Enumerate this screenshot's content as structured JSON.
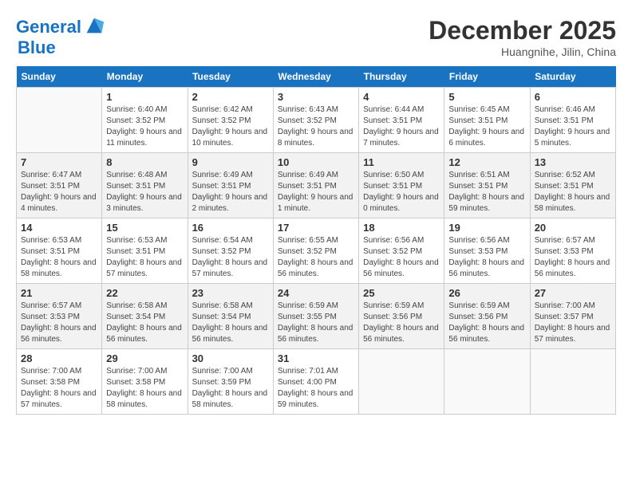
{
  "header": {
    "logo_line1": "General",
    "logo_line2": "Blue",
    "month": "December 2025",
    "location": "Huangnihe, Jilin, China"
  },
  "weekdays": [
    "Sunday",
    "Monday",
    "Tuesday",
    "Wednesday",
    "Thursday",
    "Friday",
    "Saturday"
  ],
  "weeks": [
    [
      {
        "day": "",
        "empty": true
      },
      {
        "day": "1",
        "sunrise": "6:40 AM",
        "sunset": "3:52 PM",
        "daylight": "9 hours and 11 minutes."
      },
      {
        "day": "2",
        "sunrise": "6:42 AM",
        "sunset": "3:52 PM",
        "daylight": "9 hours and 10 minutes."
      },
      {
        "day": "3",
        "sunrise": "6:43 AM",
        "sunset": "3:52 PM",
        "daylight": "9 hours and 8 minutes."
      },
      {
        "day": "4",
        "sunrise": "6:44 AM",
        "sunset": "3:51 PM",
        "daylight": "9 hours and 7 minutes."
      },
      {
        "day": "5",
        "sunrise": "6:45 AM",
        "sunset": "3:51 PM",
        "daylight": "9 hours and 6 minutes."
      },
      {
        "day": "6",
        "sunrise": "6:46 AM",
        "sunset": "3:51 PM",
        "daylight": "9 hours and 5 minutes."
      }
    ],
    [
      {
        "day": "7",
        "sunrise": "6:47 AM",
        "sunset": "3:51 PM",
        "daylight": "9 hours and 4 minutes."
      },
      {
        "day": "8",
        "sunrise": "6:48 AM",
        "sunset": "3:51 PM",
        "daylight": "9 hours and 3 minutes."
      },
      {
        "day": "9",
        "sunrise": "6:49 AM",
        "sunset": "3:51 PM",
        "daylight": "9 hours and 2 minutes."
      },
      {
        "day": "10",
        "sunrise": "6:49 AM",
        "sunset": "3:51 PM",
        "daylight": "9 hours and 1 minute."
      },
      {
        "day": "11",
        "sunrise": "6:50 AM",
        "sunset": "3:51 PM",
        "daylight": "9 hours and 0 minutes."
      },
      {
        "day": "12",
        "sunrise": "6:51 AM",
        "sunset": "3:51 PM",
        "daylight": "8 hours and 59 minutes."
      },
      {
        "day": "13",
        "sunrise": "6:52 AM",
        "sunset": "3:51 PM",
        "daylight": "8 hours and 58 minutes."
      }
    ],
    [
      {
        "day": "14",
        "sunrise": "6:53 AM",
        "sunset": "3:51 PM",
        "daylight": "8 hours and 58 minutes."
      },
      {
        "day": "15",
        "sunrise": "6:53 AM",
        "sunset": "3:51 PM",
        "daylight": "8 hours and 57 minutes."
      },
      {
        "day": "16",
        "sunrise": "6:54 AM",
        "sunset": "3:52 PM",
        "daylight": "8 hours and 57 minutes."
      },
      {
        "day": "17",
        "sunrise": "6:55 AM",
        "sunset": "3:52 PM",
        "daylight": "8 hours and 56 minutes."
      },
      {
        "day": "18",
        "sunrise": "6:56 AM",
        "sunset": "3:52 PM",
        "daylight": "8 hours and 56 minutes."
      },
      {
        "day": "19",
        "sunrise": "6:56 AM",
        "sunset": "3:53 PM",
        "daylight": "8 hours and 56 minutes."
      },
      {
        "day": "20",
        "sunrise": "6:57 AM",
        "sunset": "3:53 PM",
        "daylight": "8 hours and 56 minutes."
      }
    ],
    [
      {
        "day": "21",
        "sunrise": "6:57 AM",
        "sunset": "3:53 PM",
        "daylight": "8 hours and 56 minutes."
      },
      {
        "day": "22",
        "sunrise": "6:58 AM",
        "sunset": "3:54 PM",
        "daylight": "8 hours and 56 minutes."
      },
      {
        "day": "23",
        "sunrise": "6:58 AM",
        "sunset": "3:54 PM",
        "daylight": "8 hours and 56 minutes."
      },
      {
        "day": "24",
        "sunrise": "6:59 AM",
        "sunset": "3:55 PM",
        "daylight": "8 hours and 56 minutes."
      },
      {
        "day": "25",
        "sunrise": "6:59 AM",
        "sunset": "3:56 PM",
        "daylight": "8 hours and 56 minutes."
      },
      {
        "day": "26",
        "sunrise": "6:59 AM",
        "sunset": "3:56 PM",
        "daylight": "8 hours and 56 minutes."
      },
      {
        "day": "27",
        "sunrise": "7:00 AM",
        "sunset": "3:57 PM",
        "daylight": "8 hours and 57 minutes."
      }
    ],
    [
      {
        "day": "28",
        "sunrise": "7:00 AM",
        "sunset": "3:58 PM",
        "daylight": "8 hours and 57 minutes."
      },
      {
        "day": "29",
        "sunrise": "7:00 AM",
        "sunset": "3:58 PM",
        "daylight": "8 hours and 58 minutes."
      },
      {
        "day": "30",
        "sunrise": "7:00 AM",
        "sunset": "3:59 PM",
        "daylight": "8 hours and 58 minutes."
      },
      {
        "day": "31",
        "sunrise": "7:01 AM",
        "sunset": "4:00 PM",
        "daylight": "8 hours and 59 minutes."
      },
      {
        "day": "",
        "empty": true
      },
      {
        "day": "",
        "empty": true
      },
      {
        "day": "",
        "empty": true
      }
    ]
  ]
}
